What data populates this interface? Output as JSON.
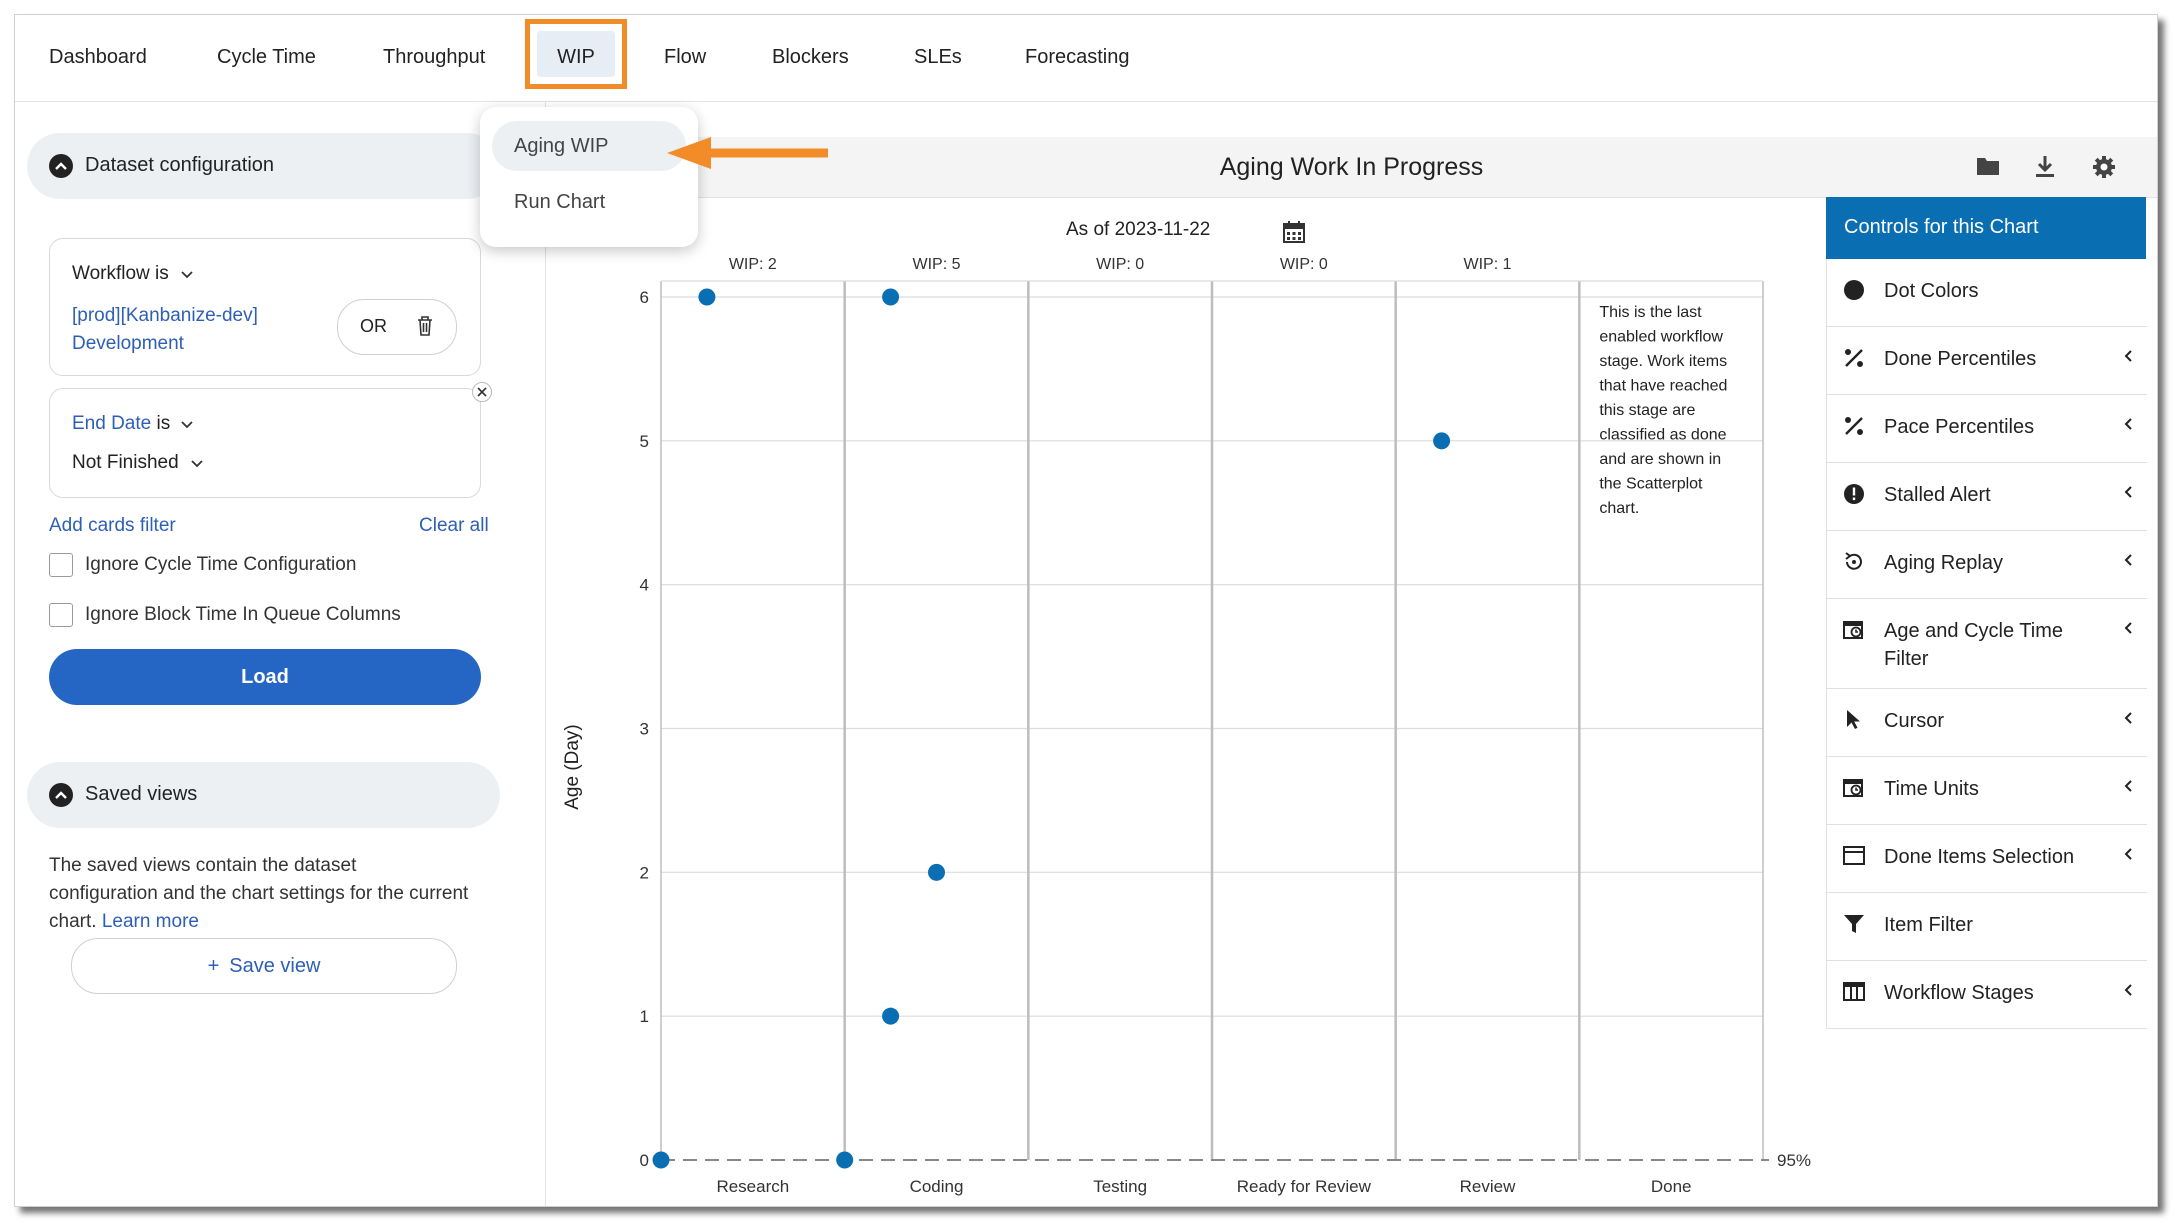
{
  "nav": {
    "tabs": [
      "Dashboard",
      "Cycle Time",
      "Throughput",
      "WIP",
      "Flow",
      "Blockers",
      "SLEs",
      "Forecasting"
    ],
    "active": "WIP"
  },
  "dropdown": {
    "items": [
      "Aging WIP",
      "Run Chart"
    ],
    "selected": "Aging WIP"
  },
  "dataset": {
    "title": "Dataset configuration",
    "workflow_label": "Workflow is",
    "workflow_value_line1": "[prod][Kanbanize-dev]",
    "workflow_value_line2": "Development",
    "or_label": "OR",
    "end_date_field": "End Date",
    "end_date_op": "is",
    "end_date_value": "Not Finished",
    "add_filter": "Add cards filter",
    "clear_all": "Clear all",
    "ignore_cycle": "Ignore Cycle Time Configuration",
    "ignore_block": "Ignore Block Time In Queue Columns",
    "load": "Load"
  },
  "saved_views": {
    "title": "Saved views",
    "description": "The saved views contain the dataset configuration and the chart settings for the current chart.",
    "learn_more": "Learn more",
    "save_view": "Save view"
  },
  "chart_header": {
    "title": "Aging Work In Progress",
    "icons": [
      "folder-icon",
      "download-icon",
      "gear-icon"
    ]
  },
  "chart_data": {
    "type": "scatter",
    "title": "Aging Work In Progress",
    "as_of_label": "As of 2023-11-22",
    "ylabel": "Age (Day)",
    "ylim": [
      0,
      6
    ],
    "yticks": [
      0,
      1,
      2,
      3,
      4,
      5,
      6
    ],
    "grid": true,
    "categories": [
      "Research",
      "Coding",
      "Testing",
      "Ready for Review",
      "Review",
      "Done"
    ],
    "wip_labels": [
      "WIP: 2",
      "WIP: 5",
      "WIP: 0",
      "WIP: 0",
      "WIP: 1"
    ],
    "points": [
      {
        "stage": "Research",
        "offset": -0.25,
        "age": 6
      },
      {
        "stage": "Research",
        "offset": -0.5,
        "age": 0
      },
      {
        "stage": "Coding",
        "offset": -0.25,
        "age": 6
      },
      {
        "stage": "Coding",
        "offset": 0,
        "age": 2
      },
      {
        "stage": "Coding",
        "offset": -0.25,
        "age": 1
      },
      {
        "stage": "Coding",
        "offset": -0.5,
        "age": 0
      },
      {
        "stage": "Review",
        "offset": -0.25,
        "age": 5
      }
    ],
    "percentile_label": "95%",
    "percentile_value": 0,
    "done_note": [
      "This is the last",
      "enabled workflow",
      "stage. Work items",
      "that have reached",
      "this stage are",
      "classified as done",
      "and are shown in",
      "the Scatterplot",
      "chart."
    ],
    "dot_color": "#0a6eb2"
  },
  "controls": {
    "title": "Controls for this Chart",
    "items": [
      {
        "label": "Dot Colors",
        "icon": "dot-icon",
        "expandable": false
      },
      {
        "label": "Done Percentiles",
        "icon": "percent-icon",
        "expandable": true
      },
      {
        "label": "Pace Percentiles",
        "icon": "percent-icon",
        "expandable": true
      },
      {
        "label": "Stalled Alert",
        "icon": "alert-icon",
        "expandable": true
      },
      {
        "label": "Aging Replay",
        "icon": "replay-icon",
        "expandable": true
      },
      {
        "label": "Age and Cycle Time",
        "label2": "Filter",
        "icon": "calendar-icon",
        "expandable": true
      },
      {
        "label": "Cursor",
        "icon": "cursor-icon",
        "expandable": true
      },
      {
        "label": "Time Units",
        "icon": "calendar-icon",
        "expandable": true
      },
      {
        "label": "Done Items Selection",
        "icon": "window-icon",
        "expandable": true
      },
      {
        "label": "Item Filter",
        "icon": "filter-icon",
        "expandable": false
      },
      {
        "label": "Workflow Stages",
        "icon": "columns-icon",
        "expandable": true
      }
    ]
  },
  "colors": {
    "accent": "#0a6eb2",
    "button": "#2566c4",
    "highlight": "#f28c28",
    "link": "#2d5fb5"
  }
}
